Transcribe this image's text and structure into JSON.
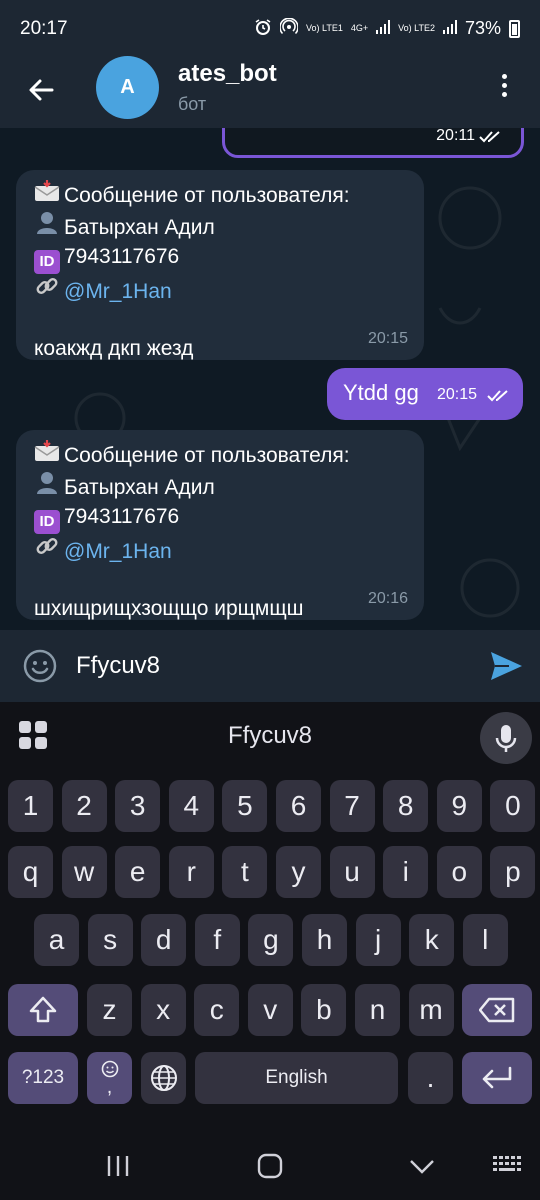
{
  "status_bar": {
    "time": "20:17",
    "sim1": "Vo) LTE1",
    "sim2": "Vo) LTE2",
    "net": "4G+",
    "battery": "73%"
  },
  "header": {
    "avatar_letter": "A",
    "title": "ates_bot",
    "subtitle": "бот"
  },
  "messages": {
    "previous": {
      "time": "20:11"
    },
    "incoming_1": {
      "header": "Сообщение от пользователя:",
      "name": "Батырхан Адил",
      "id_badge": "ID",
      "user_id": "7943117676",
      "username": "@Mr_1Han",
      "text": "коакжд  дкп жезд",
      "time": "20:15"
    },
    "outgoing_1": {
      "text": "Ytdd gg",
      "time": "20:15"
    },
    "incoming_2": {
      "header": "Сообщение от пользователя:",
      "name": "Батырхан Адил",
      "id_badge": "ID",
      "user_id": "7943117676",
      "username": "@Mr_1Han",
      "text": "шхищрищхзощщо ирщмщш",
      "time": "20:16"
    }
  },
  "composer": {
    "text": "Ffycuv8"
  },
  "keyboard": {
    "suggestion": "Ffycuv8",
    "number_row": [
      "1",
      "2",
      "3",
      "4",
      "5",
      "6",
      "7",
      "8",
      "9",
      "0"
    ],
    "row1": [
      "q",
      "w",
      "e",
      "r",
      "t",
      "y",
      "u",
      "i",
      "o",
      "p"
    ],
    "row2": [
      "a",
      "s",
      "d",
      "f",
      "g",
      "h",
      "j",
      "k",
      "l"
    ],
    "row3": [
      "z",
      "x",
      "c",
      "v",
      "b",
      "n",
      "m"
    ],
    "symbols_key": "?123",
    "comma_key": ",",
    "space_label": "English",
    "period_key": "."
  },
  "colors": {
    "accent_outgoing": "#7a56d6",
    "incoming_bubble": "#212d3b",
    "link": "#6cb4ee",
    "send": "#4aa3df"
  }
}
